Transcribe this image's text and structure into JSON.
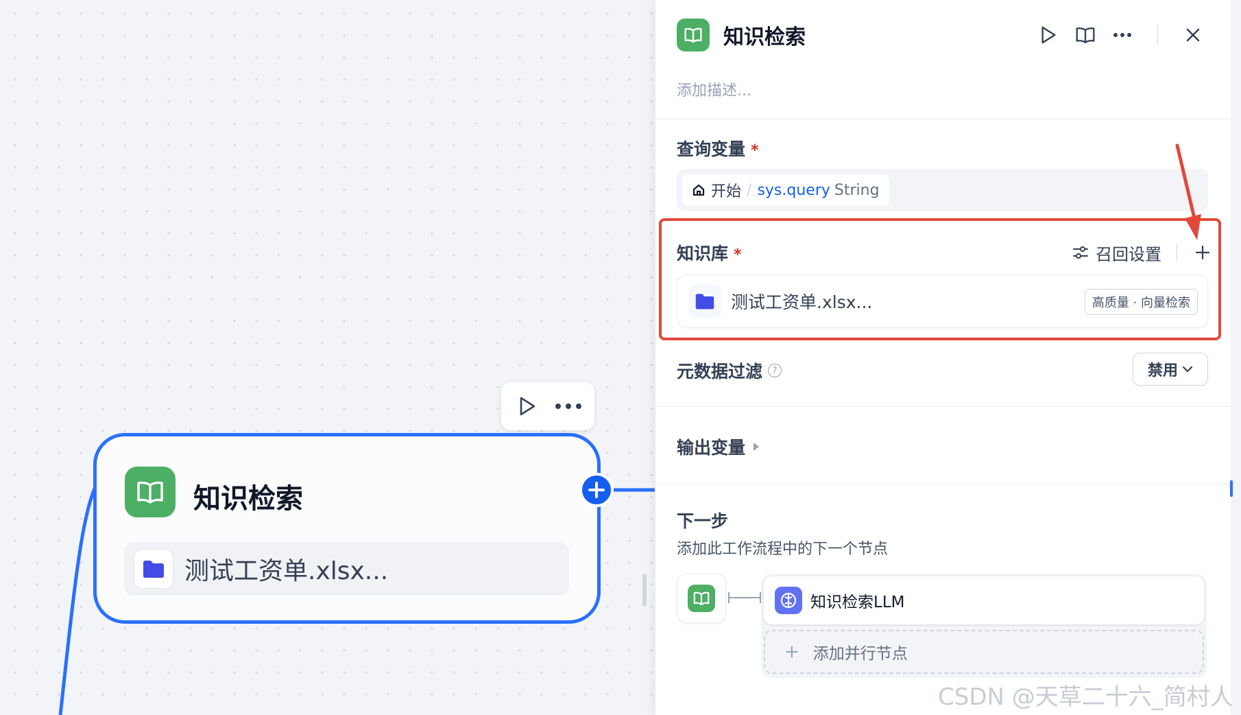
{
  "canvas": {
    "toolbar": {
      "run_icon": "play-icon",
      "more_icon": "more-horizontal-icon"
    },
    "node": {
      "icon": "book-open-icon",
      "title": "知识检索",
      "kb_icon": "folder-icon",
      "kb_name": "测试工资单.xlsx..."
    },
    "add_handle_icon": "plus-icon"
  },
  "panel": {
    "title": "知识检索",
    "title_icon": "book-open-icon",
    "actions": [
      "play-icon",
      "book-icon",
      "more-horizontal-icon",
      "close-icon"
    ],
    "description_placeholder": "添加描述...",
    "query": {
      "label": "查询变量",
      "required_mark": "*",
      "source_icon": "home-icon",
      "source": "开始",
      "separator": "/",
      "variable": "sys.query",
      "type": "String"
    },
    "knowledge": {
      "label": "知识库",
      "required_mark": "*",
      "recall_icon": "sliders-icon",
      "recall_label": "召回设置",
      "add_icon": "plus-icon",
      "item": {
        "icon": "folder-icon",
        "name": "测试工资单.xlsx...",
        "badge": "高质量 · 向量检索"
      }
    },
    "metadata_filter": {
      "label": "元数据过滤",
      "help_icon": "help-circle-icon",
      "help_glyph": "?",
      "value": "禁用"
    },
    "output": {
      "label": "输出变量"
    },
    "next": {
      "title": "下一步",
      "description": "添加此工作流程中的下一个节点",
      "node_name": "知识检索LLM",
      "node_icon": "llm-brain-icon",
      "add_parallel_plus": "+",
      "add_parallel": "添加并行节点"
    }
  },
  "colors": {
    "accent": "#2970ff",
    "node_green": "#4caf64",
    "highlight_red": "#e0493a",
    "required_red": "#d92d20",
    "link_blue": "#155eef",
    "llm_purple": "#6172f3"
  },
  "watermark": "CSDN @天草二十六_简村人"
}
